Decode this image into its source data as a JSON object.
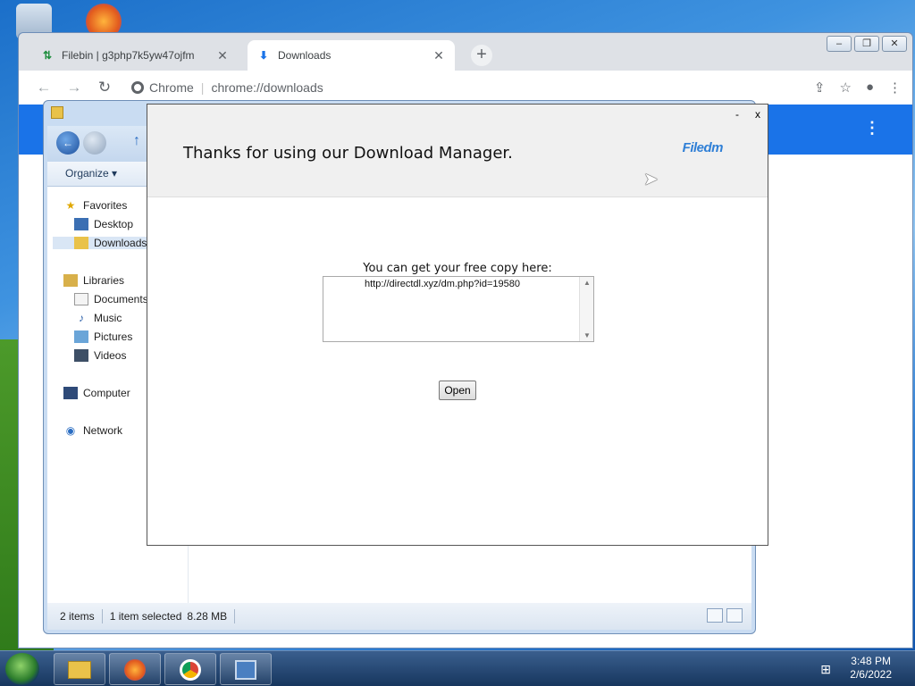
{
  "chrome": {
    "tabs": [
      {
        "title": "Filebin | g3php7k5yw47ojfm",
        "icon": "filebin-icon",
        "active": false
      },
      {
        "title": "Downloads",
        "icon": "download-icon",
        "active": true
      }
    ],
    "new_tab": "+",
    "omnibox": {
      "site": "Chrome",
      "url": "chrome://downloads"
    }
  },
  "explorer": {
    "organize": "Organize ▾",
    "nav": {
      "favorites": "Favorites",
      "desktop": "Desktop",
      "downloads": "Downloads",
      "libraries": "Libraries",
      "documents": "Documents",
      "music": "Music",
      "pictures": "Pictures",
      "videos": "Videos",
      "computer": "Computer",
      "network": "Network"
    },
    "status": {
      "items": "2 items",
      "selected": "1 item selected",
      "size": "8.28 MB"
    }
  },
  "popup": {
    "title": "Thanks for using our Download Manager.",
    "logo": "Filedm",
    "min": "-",
    "close": "x",
    "prompt": "You can get your free copy here:",
    "link": "http://directdl.xyz/dm.php?id=19580",
    "open_label": "Open"
  },
  "taskbar": {
    "time": "3:48 PM",
    "date": "2/6/2022"
  },
  "colors": {
    "accent": "#1a73e8",
    "logo": "#2f7fd6"
  }
}
